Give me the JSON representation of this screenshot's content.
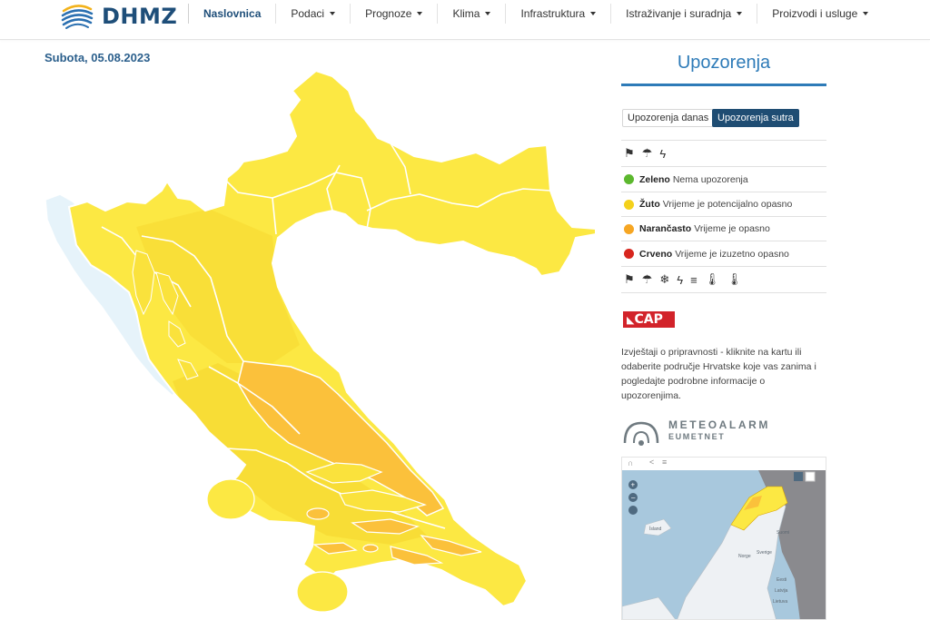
{
  "header": {
    "logo_text": "DHMZ",
    "nav": [
      {
        "label": "Naslovnica",
        "has_caret": false
      },
      {
        "label": "Podaci",
        "has_caret": true
      },
      {
        "label": "Prognoze",
        "has_caret": true
      },
      {
        "label": "Klima",
        "has_caret": true
      },
      {
        "label": "Infrastruktura",
        "has_caret": true
      },
      {
        "label": "Istraživanje i suradnja",
        "has_caret": true
      },
      {
        "label": "Proizvodi i usluge",
        "has_caret": true
      }
    ]
  },
  "date": "Subota, 05.08.2023",
  "map": {
    "colors": {
      "sea_white": "#e6f3fa",
      "yellow": "#fce843",
      "yellow_inner": "#fae23c",
      "orange": "#fbc13b",
      "border": "#ffffff"
    }
  },
  "sidebar": {
    "title": "Upozorenja",
    "tabs": {
      "today": "Upozorenja danas",
      "tomorrow": "Upozorenja sutra"
    },
    "top_icons": [
      "wind-icon",
      "rain-icon",
      "thunder-icon"
    ],
    "legend": [
      {
        "name": "Zeleno",
        "desc": "Nema upozorenja",
        "color": "#5cb82e"
      },
      {
        "name": "Žuto",
        "desc": "Vrijeme je potencijalno opasno",
        "color": "#f4d11b"
      },
      {
        "name": "Narančasto",
        "desc": "Vrijeme je opasno",
        "color": "#f6a623"
      },
      {
        "name": "Crveno",
        "desc": "Vrijeme je izuzetno opasno",
        "color": "#d7261e"
      }
    ],
    "bottom_icons": [
      "wind-icon",
      "rain-icon",
      "snow-ice-icon",
      "thunder-icon",
      "fog-icon",
      "high-temperature-icon",
      "low-temperature-icon"
    ],
    "cap_label": "CAP",
    "info_text": "Izvještaji o pripravnosti - kliknite na kartu ili odaberite područje Hrvatske koje vas zanima i pogledajte podrobne informacije o upozorenjima.",
    "meteoalarm": {
      "name": "METEOALARM",
      "sub": "EUMETNET"
    },
    "widget_labels": {
      "iceland": "Ísland",
      "norway": "Norge",
      "sweden": "Sverige",
      "finland": "Suomi",
      "estonia": "Eesti",
      "latvia": "Latvija",
      "lithuania": "Lietuva"
    }
  }
}
